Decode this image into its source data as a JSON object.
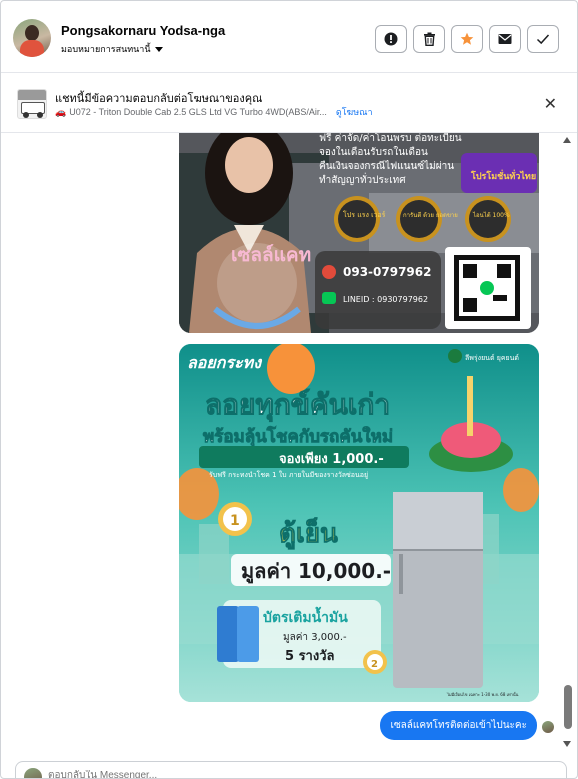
{
  "header": {
    "user_name": "Pongsakornaru Yodsa-nga",
    "assign_label": "มอบหมายการสนทนานี้",
    "actions": [
      {
        "name": "report-button",
        "icon": "exclamation-icon"
      },
      {
        "name": "delete-button",
        "icon": "trash-icon"
      },
      {
        "name": "star-button",
        "icon": "star-icon",
        "color": "#f7923a"
      },
      {
        "name": "mark-unread-button",
        "icon": "envelope-icon"
      },
      {
        "name": "mark-done-button",
        "icon": "check-icon"
      }
    ]
  },
  "ad_bar": {
    "title": "แชทนี้มีข้อความตอบกลับต่อโฆษณาของคุณ",
    "subtitle": "U072 - Triton Double Cab 2.5 GLS Ltd VG Turbo 4WD(ABS/Air...",
    "link": "ดูโฆษณา"
  },
  "messages": {
    "image1": {
      "promo_lines": [
        "ฟรี ค่าจัด/ค่าโอนพรบ ต่อทะเบียน",
        "จองในเดือนรับรถในเดือน",
        "คืนเงินจองกรณีไฟแนนซ์ไม่ผ่าน",
        "ทำสัญญาทั่วประเทศ"
      ],
      "corner_text": "โปรโมชั่นทั่วไทย",
      "name_sign": "เซลล์แคท",
      "badges": [
        "โปร แรง เวอร์",
        "การันตี ด้วย ยอดขาย",
        "ไอนไต้ 100%"
      ],
      "phone": "093-0797962",
      "line_id": "LINEID : 0930797962"
    },
    "image2": {
      "corner_title": "ลอยกระทง",
      "brand": "ลีพรุ่งยนต์ ยุคยนต์",
      "headline1": "ลอยทุกข์คันเก่า",
      "headline2": "พร้อมลุ้นโชคกับรถคันใหม่",
      "booking": "จองเพียง 1,000.-",
      "sub": "รับฟรี กระทงนำโชค 1 ใบ ภายในมีของรางวัลซ่อนอยู่",
      "prize1_label": "ตู้เย็น",
      "prize1_value": "มูลค่า 10,000.-",
      "prize2_label": "บัตรเติมน้ำมัน",
      "prize2_value": "มูลค่า 3,000.-",
      "prize2_count": "5 รางวัล",
      "footnote": "ไม่มีเงื่อนไข เฉพาะ 1-30 พ.ย. 68 เท่านั้น",
      "badge1": "1",
      "badge2": "2"
    },
    "outgoing_text": "เซลล์แคทโทรติดต่อเข้าไปนะคะ"
  },
  "composer": {
    "placeholder": "ตอบกลับใน Messenger..."
  },
  "colors": {
    "accent_blue": "#1877f2",
    "star_orange": "#f7923a"
  }
}
